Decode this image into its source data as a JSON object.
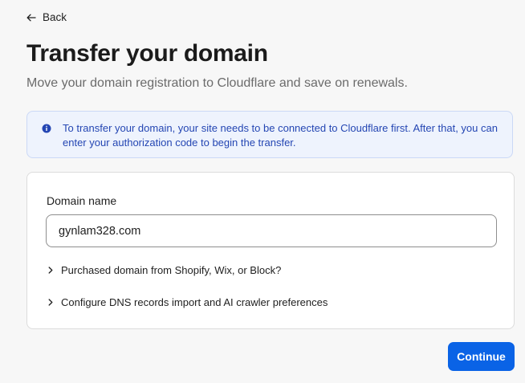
{
  "back_link": {
    "label": "Back",
    "icon": "arrow-left-icon"
  },
  "page": {
    "title": "Transfer your domain",
    "subtitle": "Move your domain registration to Cloudflare and save on renewals."
  },
  "info_banner": {
    "icon": "info-icon",
    "text": "To transfer your domain, your site needs to be connected to Cloudflare first. After that, you can enter your authorization code to begin the transfer."
  },
  "form": {
    "domain_label": "Domain name",
    "domain_value": "gynlam328.com",
    "expanders": {
      "shopify": "Purchased domain from Shopify, Wix, or Block?",
      "dns": "Configure DNS records import and AI crawler preferences"
    }
  },
  "actions": {
    "continue_label": "Continue"
  },
  "colors": {
    "accent": "#0a63e6",
    "banner_bg": "#eef3fd",
    "banner_text": "#2446b3"
  }
}
